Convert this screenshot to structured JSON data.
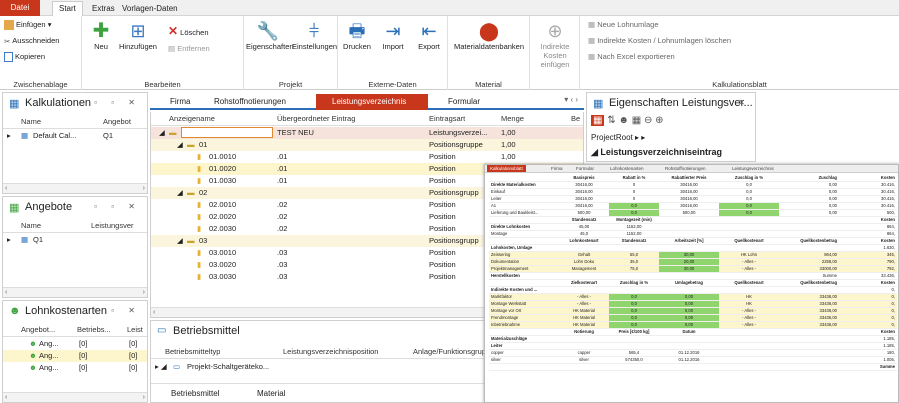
{
  "menu": {
    "file": "Datei",
    "tabs": [
      "Start",
      "Extras",
      "Vorlagen-Daten"
    ]
  },
  "ribbon": {
    "clipboard": {
      "paste": "Einfügen",
      "cut": "Ausschneiden",
      "copy": "Kopieren",
      "label": "Zwischenablage"
    },
    "edit": {
      "new": "Neu",
      "add": "Hinzufügen",
      "delete": "Löschen",
      "remove": "Entfernen",
      "label": "Bearbeiten"
    },
    "project": {
      "properties": "Eigenschaften",
      "settings": "Einstellungen",
      "label": "Projekt"
    },
    "external": {
      "print": "Drucken",
      "import": "Import",
      "export": "Export",
      "label": "Externe-Daten"
    },
    "material": {
      "db": "Materialdatenbanken",
      "label": "Material"
    },
    "indirect": {
      "label": "Indirekte Kosten einfügen"
    },
    "calc": {
      "new_wage": "Neue Lohnumlage",
      "indirect_wage": "Indirekte Kosten / Lohnumlagen löschen",
      "excel": "Nach Excel exportieren",
      "label": "Kalkulationsblatt"
    }
  },
  "kalk": {
    "title": "Kalkulationen",
    "cols": [
      "Name",
      "Angebot"
    ],
    "row": {
      "name": "Default Cal...",
      "angebot": "Q1"
    }
  },
  "angebote": {
    "title": "Angebote",
    "cols": [
      "Name",
      "Leistungsver"
    ],
    "row": {
      "name": "Q1"
    }
  },
  "lohn": {
    "title": "Lohnkostenarten",
    "cols": [
      "Angebot...",
      "Betriebs...",
      "Leist"
    ],
    "rows": [
      [
        "Ang...",
        "[0]",
        "[0]"
      ],
      [
        "Ang...",
        "[0]",
        "[0]"
      ],
      [
        "Ang...",
        "[0]",
        "[0]"
      ]
    ]
  },
  "doctabs": [
    "Firma",
    "Rohstoffnotierungen",
    "Leistungsverzeichnis",
    "Formular"
  ],
  "grid": {
    "cols": [
      "Anzeigename",
      "Übergeordneter Eintrag",
      "Eintragsart",
      "Menge",
      "Be"
    ],
    "rows": [
      {
        "name": "",
        "parent": "TEST NEU",
        "type": "Leistungsverzei...",
        "qty": "1,00",
        "lvl": 0
      },
      {
        "name": "01",
        "parent": "",
        "type": "Positionsgruppe",
        "qty": "1,00",
        "lvl": 1
      },
      {
        "name": "01.0010",
        "parent": ".01",
        "type": "Position",
        "qty": "1,00",
        "lvl": 2
      },
      {
        "name": "01.0020",
        "parent": ".01",
        "type": "Position",
        "qty": "1,00",
        "lvl": 2
      },
      {
        "name": "01.0030",
        "parent": ".01",
        "type": "Position",
        "qty": "",
        "lvl": 2
      },
      {
        "name": "02",
        "parent": "",
        "type": "Positionsgrupp",
        "qty": "",
        "lvl": 1
      },
      {
        "name": "02.0010",
        "parent": ".02",
        "type": "Position",
        "qty": "",
        "lvl": 2
      },
      {
        "name": "02.0020",
        "parent": ".02",
        "type": "Position",
        "qty": "",
        "lvl": 2
      },
      {
        "name": "02.0030",
        "parent": ".02",
        "type": "Position",
        "qty": "",
        "lvl": 2
      },
      {
        "name": "03",
        "parent": "",
        "type": "Positionsgrupp",
        "qty": "",
        "lvl": 1
      },
      {
        "name": "03.0010",
        "parent": ".03",
        "type": "Position",
        "qty": "",
        "lvl": 2
      },
      {
        "name": "03.0020",
        "parent": ".03",
        "type": "Position",
        "qty": "",
        "lvl": 2
      },
      {
        "name": "03.0030",
        "parent": ".03",
        "type": "Position",
        "qty": "",
        "lvl": 2
      }
    ]
  },
  "betrieb": {
    "title": "Betriebsmittel",
    "cols": [
      "Betriebsmitteltyp",
      "Leistungsverzeichnisposition",
      "Anlage/Funktionsgrupp"
    ],
    "row": "Projekt-Schaltgeräteko...",
    "tabs": [
      "Betriebsmittel",
      "Material"
    ]
  },
  "props": {
    "title": "Eigenschaften Leistungsver...",
    "path": "ProjectRoot",
    "section": "Leistungsverzeichniseintrag"
  },
  "report": {
    "tabs": [
      "Kalkulationsblatt",
      "Firma",
      "Formular",
      "Lohnkostenarten",
      "Rohstoffnotierungen",
      "Leistungsverzeichnis"
    ],
    "header": [
      "",
      "Basispreis",
      "Rabatt in %",
      "Rabattierter Preis",
      "Zuschlag in %",
      "Zuschlag",
      "Kosten"
    ],
    "rows": [
      [
        "Direkte Materialkosten",
        "30416,00",
        "0",
        "30416,00",
        "0,0",
        "0,00",
        "30.416,"
      ],
      [
        "Einkauf",
        "30416,00",
        "0",
        "30416,00",
        "0,0",
        "0,00",
        "30.416,"
      ],
      [
        "Leiter",
        "30416,00",
        "0",
        "30416,00",
        "0,0",
        "0,00",
        "30.416,"
      ],
      [
        "A1",
        "30416,00",
        "0,0",
        "30416,00",
        "0,0",
        "0,00",
        "30.416,"
      ],
      [
        "Lieferung und Baukleist...",
        "500,00",
        "0,0",
        "500,00",
        "0,0",
        "0,00",
        "500,"
      ]
    ],
    "wage_head": [
      "",
      "Standensatz",
      "Montagezeit (min)",
      "",
      "",
      "",
      "Kosten"
    ],
    "wage_rows": [
      [
        "Direkte Lohnkosten",
        "45,00",
        "1152,00",
        "",
        "",
        "",
        "864,"
      ],
      [
        "Montage",
        "45,0",
        "1152,00",
        "",
        "",
        "",
        "864,"
      ]
    ],
    "lk_head": [
      "",
      "Lohnkostenart",
      "Standensatz",
      "Arbeitszeit [%]",
      "Quellkostenart",
      "Quellkostenbetrag",
      "Kosten"
    ],
    "lk_rows": [
      [
        "Lohnkosten, Umlage",
        "",
        "",
        "",
        "",
        "",
        "1.630,"
      ],
      [
        "Zeissering",
        "Gehalt",
        "55,0",
        "30,00",
        "HK Lohn",
        "864,00",
        "345,"
      ],
      [
        "Dokumentation",
        "Lohn Doku",
        "35,0",
        "20,00",
        "- Alles -",
        "2258,00",
        "790,"
      ],
      [
        "Projektmanagement",
        "Management",
        "75,0",
        "30,00",
        "- Alles -",
        "33000,00",
        "792,"
      ]
    ],
    "hk": [
      "Herstellkosten",
      "",
      "",
      "",
      "",
      "Summe",
      "33.436,"
    ],
    "ik_head": [
      "",
      "Zielkostenart",
      "Zuschlag in %",
      "Umlagebetrag",
      "Quellkostenart",
      "Quellkostenbetrag",
      "Kosten"
    ],
    "ik_rows": [
      [
        "Indirekte Kosten und ...",
        "",
        "",
        "",
        "",
        "",
        "0,"
      ],
      [
        "Marktfaktor",
        "- Alles -",
        "0,0",
        "0,00",
        "HK",
        "33436,00",
        "0,"
      ],
      [
        "Montage Werkstatt",
        "- Alles -",
        "0,0",
        "0,00",
        "HK",
        "33436,00",
        "0,"
      ],
      [
        "Montage vor Ort",
        "HK Material",
        "0,0",
        "0,00",
        "- Alles -",
        "33436,00",
        "0,"
      ],
      [
        "Frendmontage",
        "HK Material",
        "0,0",
        "0,00",
        "- Alles -",
        "33436,00",
        "0,"
      ],
      [
        "Inbetriebnahme",
        "HK Material",
        "0,0",
        "0,00",
        "- Alles -",
        "33436,00",
        "0,"
      ]
    ],
    "mz_head": [
      "",
      "Notierung",
      "Preis [€/100 kg]",
      "Datum",
      "",
      "",
      "Kosten"
    ],
    "mz_rows": [
      [
        "Materialzuschläge",
        "",
        "",
        "",
        "",
        "",
        "1.185,"
      ],
      [
        "Leiter",
        "",
        "",
        "",
        "",
        "",
        "1.185,"
      ],
      [
        "copper",
        "copper",
        "565,4",
        "01.12.2016",
        "",
        "",
        "180,"
      ],
      [
        "silver",
        "silver",
        "574350,0",
        "01.12.2016",
        "",
        "",
        "1.005,"
      ]
    ],
    "sum": [
      "",
      "",
      "",
      "",
      "",
      "",
      "Summe"
    ]
  },
  "colors": {
    "accent": "#c8361c",
    "blue": "#2a6fb8",
    "green": "#8fd46c",
    "yellow": "#fdf5cc"
  }
}
